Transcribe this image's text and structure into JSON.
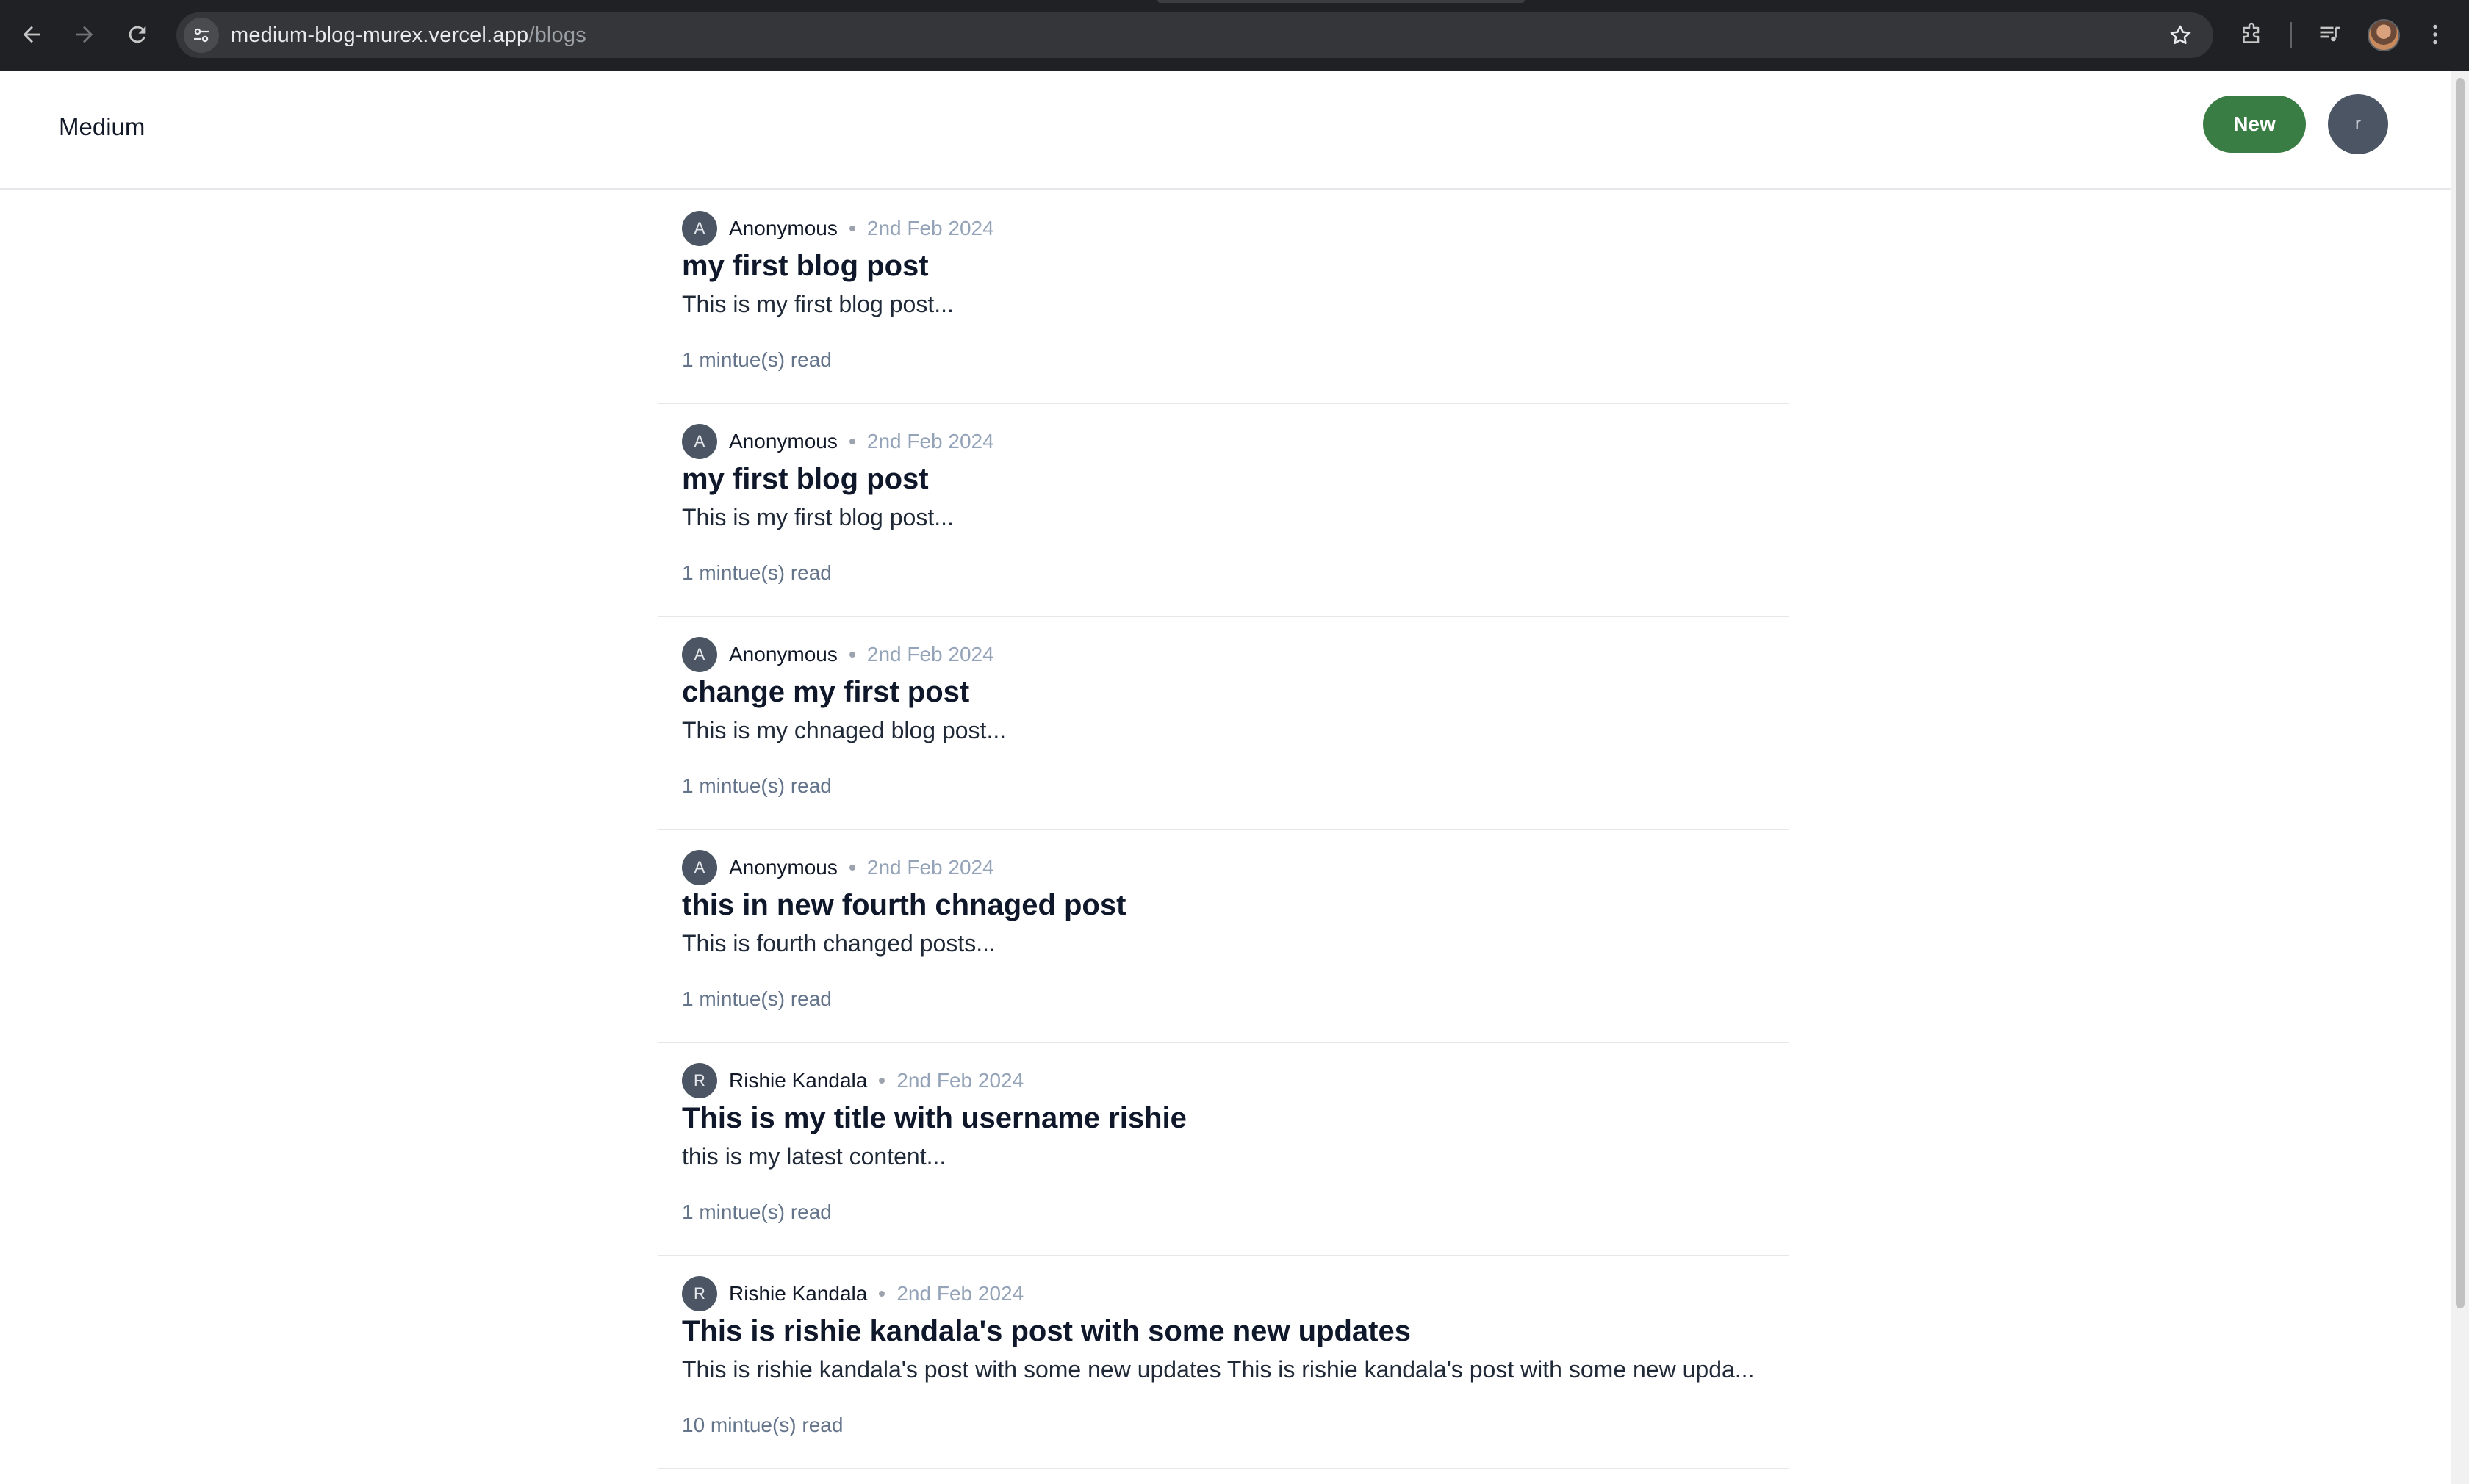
{
  "browser": {
    "url_host": "medium-blog-murex.vercel.app",
    "url_path": "/blogs"
  },
  "app": {
    "brand": "Medium",
    "new_button": "New",
    "user_initial": "r"
  },
  "posts": [
    {
      "initial": "A",
      "author": "Anonymous",
      "date": "2nd Feb 2024",
      "title": "my first blog post",
      "excerpt": "This is my first blog post...",
      "read_time": "1 mintue(s) read"
    },
    {
      "initial": "A",
      "author": "Anonymous",
      "date": "2nd Feb 2024",
      "title": "my first blog post",
      "excerpt": "This is my first blog post...",
      "read_time": "1 mintue(s) read"
    },
    {
      "initial": "A",
      "author": "Anonymous",
      "date": "2nd Feb 2024",
      "title": "change my first post",
      "excerpt": "This is my chnaged blog post...",
      "read_time": "1 mintue(s) read"
    },
    {
      "initial": "A",
      "author": "Anonymous",
      "date": "2nd Feb 2024",
      "title": "this in new fourth chnaged post",
      "excerpt": "This is fourth changed posts...",
      "read_time": "1 mintue(s) read"
    },
    {
      "initial": "R",
      "author": "Rishie Kandala",
      "date": "2nd Feb 2024",
      "title": "This is my title with username rishie",
      "excerpt": "this is my latest content...",
      "read_time": "1 mintue(s) read"
    },
    {
      "initial": "R",
      "author": "Rishie Kandala",
      "date": "2nd Feb 2024",
      "title": "This is rishie kandala's post with some new updates",
      "excerpt": "This is rishie kandala's post with some new updates This is rishie kandala's post with some new upda...",
      "read_time": "10 mintue(s) read"
    }
  ]
}
